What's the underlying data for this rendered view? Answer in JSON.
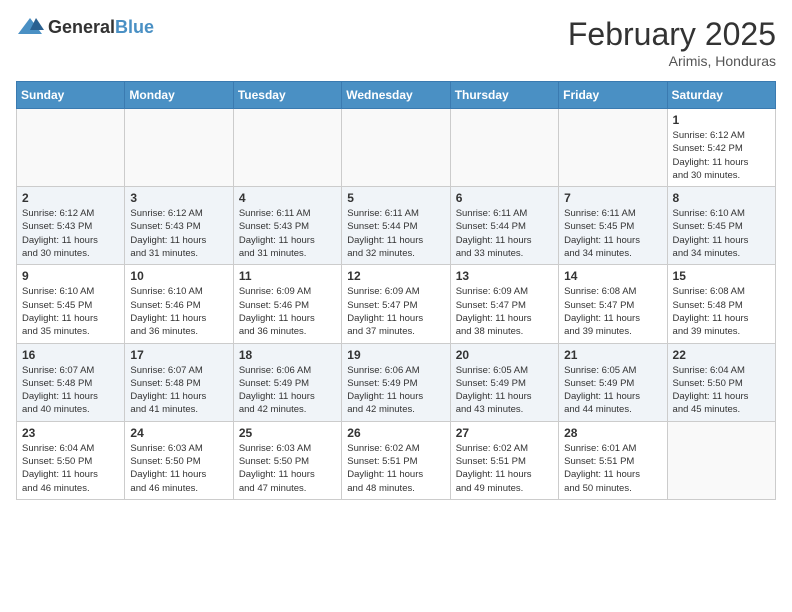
{
  "header": {
    "logo_general": "General",
    "logo_blue": "Blue",
    "month_year": "February 2025",
    "location": "Arimis, Honduras"
  },
  "days_of_week": [
    "Sunday",
    "Monday",
    "Tuesday",
    "Wednesday",
    "Thursday",
    "Friday",
    "Saturday"
  ],
  "weeks": [
    [
      {
        "day": "",
        "info": ""
      },
      {
        "day": "",
        "info": ""
      },
      {
        "day": "",
        "info": ""
      },
      {
        "day": "",
        "info": ""
      },
      {
        "day": "",
        "info": ""
      },
      {
        "day": "",
        "info": ""
      },
      {
        "day": "1",
        "info": "Sunrise: 6:12 AM\nSunset: 5:42 PM\nDaylight: 11 hours\nand 30 minutes."
      }
    ],
    [
      {
        "day": "2",
        "info": "Sunrise: 6:12 AM\nSunset: 5:43 PM\nDaylight: 11 hours\nand 30 minutes."
      },
      {
        "day": "3",
        "info": "Sunrise: 6:12 AM\nSunset: 5:43 PM\nDaylight: 11 hours\nand 31 minutes."
      },
      {
        "day": "4",
        "info": "Sunrise: 6:11 AM\nSunset: 5:43 PM\nDaylight: 11 hours\nand 31 minutes."
      },
      {
        "day": "5",
        "info": "Sunrise: 6:11 AM\nSunset: 5:44 PM\nDaylight: 11 hours\nand 32 minutes."
      },
      {
        "day": "6",
        "info": "Sunrise: 6:11 AM\nSunset: 5:44 PM\nDaylight: 11 hours\nand 33 minutes."
      },
      {
        "day": "7",
        "info": "Sunrise: 6:11 AM\nSunset: 5:45 PM\nDaylight: 11 hours\nand 34 minutes."
      },
      {
        "day": "8",
        "info": "Sunrise: 6:10 AM\nSunset: 5:45 PM\nDaylight: 11 hours\nand 34 minutes."
      }
    ],
    [
      {
        "day": "9",
        "info": "Sunrise: 6:10 AM\nSunset: 5:45 PM\nDaylight: 11 hours\nand 35 minutes."
      },
      {
        "day": "10",
        "info": "Sunrise: 6:10 AM\nSunset: 5:46 PM\nDaylight: 11 hours\nand 36 minutes."
      },
      {
        "day": "11",
        "info": "Sunrise: 6:09 AM\nSunset: 5:46 PM\nDaylight: 11 hours\nand 36 minutes."
      },
      {
        "day": "12",
        "info": "Sunrise: 6:09 AM\nSunset: 5:47 PM\nDaylight: 11 hours\nand 37 minutes."
      },
      {
        "day": "13",
        "info": "Sunrise: 6:09 AM\nSunset: 5:47 PM\nDaylight: 11 hours\nand 38 minutes."
      },
      {
        "day": "14",
        "info": "Sunrise: 6:08 AM\nSunset: 5:47 PM\nDaylight: 11 hours\nand 39 minutes."
      },
      {
        "day": "15",
        "info": "Sunrise: 6:08 AM\nSunset: 5:48 PM\nDaylight: 11 hours\nand 39 minutes."
      }
    ],
    [
      {
        "day": "16",
        "info": "Sunrise: 6:07 AM\nSunset: 5:48 PM\nDaylight: 11 hours\nand 40 minutes."
      },
      {
        "day": "17",
        "info": "Sunrise: 6:07 AM\nSunset: 5:48 PM\nDaylight: 11 hours\nand 41 minutes."
      },
      {
        "day": "18",
        "info": "Sunrise: 6:06 AM\nSunset: 5:49 PM\nDaylight: 11 hours\nand 42 minutes."
      },
      {
        "day": "19",
        "info": "Sunrise: 6:06 AM\nSunset: 5:49 PM\nDaylight: 11 hours\nand 42 minutes."
      },
      {
        "day": "20",
        "info": "Sunrise: 6:05 AM\nSunset: 5:49 PM\nDaylight: 11 hours\nand 43 minutes."
      },
      {
        "day": "21",
        "info": "Sunrise: 6:05 AM\nSunset: 5:49 PM\nDaylight: 11 hours\nand 44 minutes."
      },
      {
        "day": "22",
        "info": "Sunrise: 6:04 AM\nSunset: 5:50 PM\nDaylight: 11 hours\nand 45 minutes."
      }
    ],
    [
      {
        "day": "23",
        "info": "Sunrise: 6:04 AM\nSunset: 5:50 PM\nDaylight: 11 hours\nand 46 minutes."
      },
      {
        "day": "24",
        "info": "Sunrise: 6:03 AM\nSunset: 5:50 PM\nDaylight: 11 hours\nand 46 minutes."
      },
      {
        "day": "25",
        "info": "Sunrise: 6:03 AM\nSunset: 5:50 PM\nDaylight: 11 hours\nand 47 minutes."
      },
      {
        "day": "26",
        "info": "Sunrise: 6:02 AM\nSunset: 5:51 PM\nDaylight: 11 hours\nand 48 minutes."
      },
      {
        "day": "27",
        "info": "Sunrise: 6:02 AM\nSunset: 5:51 PM\nDaylight: 11 hours\nand 49 minutes."
      },
      {
        "day": "28",
        "info": "Sunrise: 6:01 AM\nSunset: 5:51 PM\nDaylight: 11 hours\nand 50 minutes."
      },
      {
        "day": "",
        "info": ""
      }
    ]
  ]
}
